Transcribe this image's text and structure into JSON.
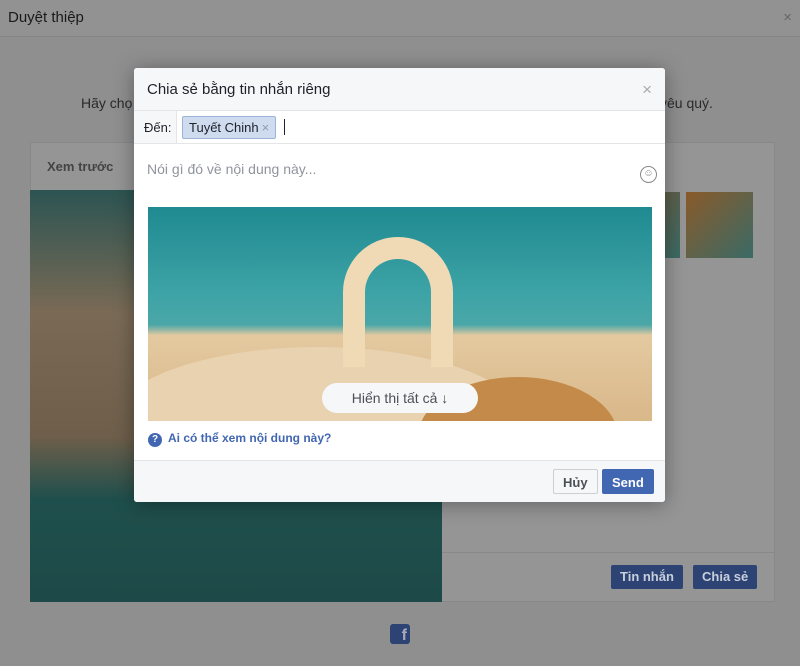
{
  "page": {
    "title": "Duyệt thiệp",
    "close": "×",
    "subtitle_left": "Hãy chọ",
    "subtitle_right": "yêu quý."
  },
  "panel": {
    "preview_label": "Xem trước",
    "message_button": "Tin nhắn",
    "share_button": "Chia sẻ",
    "fb_logo": "f"
  },
  "modal": {
    "title": "Chia sẻ bằng tin nhắn riêng",
    "close": "×",
    "to_label": "Đến:",
    "recipients": [
      {
        "name": "Tuyết Chinh",
        "remove": "×"
      }
    ],
    "message_placeholder": "Nói gì đó về nội dung này...",
    "show_all": "Hiển thị tất cả ↓",
    "who_can_see": "Ai có thể xem nội dung này?",
    "cancel": "Hủy",
    "send": "Send"
  },
  "colors": {
    "accent": "#4267b2",
    "chip": "#cfdcf0"
  }
}
